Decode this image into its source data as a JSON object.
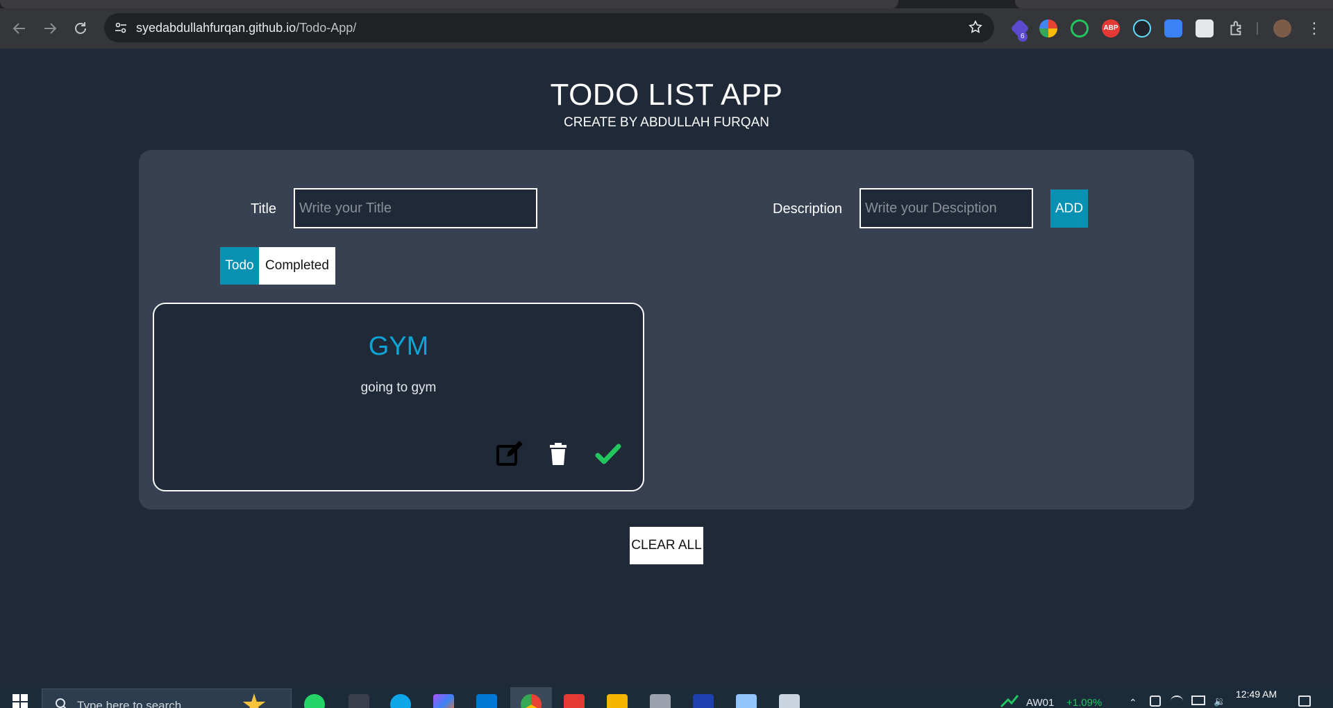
{
  "browser": {
    "url_host": "syedabdullahfurqan.github.io",
    "url_path": "/Todo-App/",
    "extension_badge": "6",
    "abp_label": "ABP"
  },
  "app": {
    "title": "TODO LIST APP",
    "subtitle": "CREATE BY ABDULLAH FURQAN"
  },
  "form": {
    "title_label": "Title",
    "title_placeholder": "Write your Title",
    "description_label": "Description",
    "description_placeholder": "Write your Desciption",
    "add_label": "ADD"
  },
  "tabs": {
    "todo": "Todo",
    "completed": "Completed"
  },
  "todos": [
    {
      "title": "GYM",
      "description": "going to gym"
    }
  ],
  "clear_all_label": "CLEAR ALL",
  "taskbar": {
    "search_placeholder": "Type here to search",
    "ticker_name": "AW01",
    "ticker_change": "+1.09%",
    "time": "12:49 AM"
  },
  "colors": {
    "accent": "#0891b2",
    "card_title": "#0ea5d6",
    "check": "#22c55e",
    "page_bg": "#1f2937",
    "panel_bg": "#374151"
  }
}
